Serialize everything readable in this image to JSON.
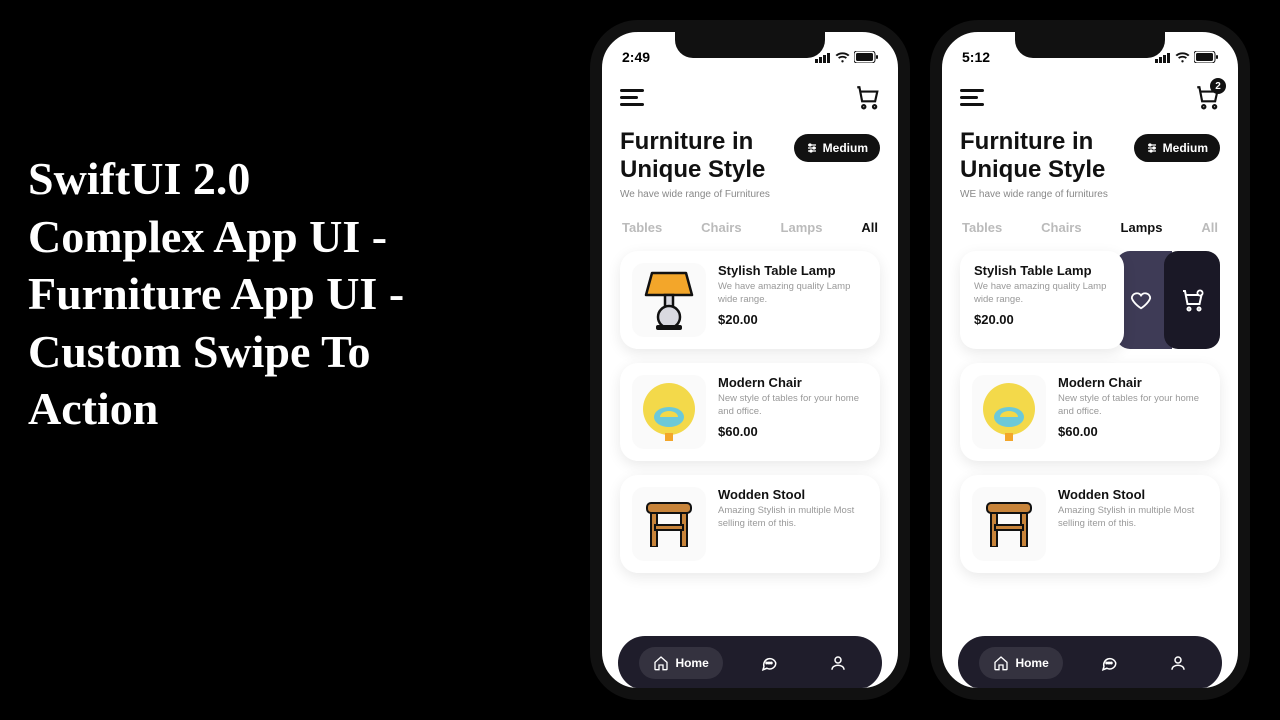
{
  "hero": "SwiftUI 2.0 Complex App UI - Furniture App UI - Custom Swipe To Action",
  "shared": {
    "title": "Furniture in Unique Style",
    "filter_label": "Medium",
    "tabs": {
      "home": "Home"
    }
  },
  "phone_left": {
    "time": "2:49",
    "subtitle": "We have wide range of Furnitures",
    "cart_badge": null,
    "categories": [
      {
        "label": "Tables",
        "active": false
      },
      {
        "label": "Chairs",
        "active": false
      },
      {
        "label": "Lamps",
        "active": false
      },
      {
        "label": "All",
        "active": true
      }
    ],
    "items": [
      {
        "name": "Stylish Table Lamp",
        "desc": "We have amazing quality Lamp wide range.",
        "price": "$20.00",
        "icon": "lamp"
      },
      {
        "name": "Modern Chair",
        "desc": "New style of tables for your home and office.",
        "price": "$60.00",
        "icon": "chair"
      },
      {
        "name": "Wodden Stool",
        "desc": "Amazing Stylish in multiple Most selling item of this.",
        "price": "",
        "icon": "stool"
      }
    ]
  },
  "phone_right": {
    "time": "5:12",
    "subtitle": "WE have wide range of furnitures",
    "cart_badge": "2",
    "categories": [
      {
        "label": "Tables",
        "active": false
      },
      {
        "label": "Chairs",
        "active": false
      },
      {
        "label": "Lamps",
        "active": true
      },
      {
        "label": "All",
        "active": false
      }
    ],
    "swiped_item": {
      "name": "Stylish Table Lamp",
      "desc": "We have amazing quality Lamp wide range.",
      "price": "$20.00"
    },
    "items_rest": [
      {
        "name": "Modern Chair",
        "desc": "New style of tables for your home and office.",
        "price": "$60.00",
        "icon": "chair"
      },
      {
        "name": "Wodden Stool",
        "desc": "Amazing Stylish in multiple Most selling item of this.",
        "price": "",
        "icon": "stool"
      }
    ]
  }
}
